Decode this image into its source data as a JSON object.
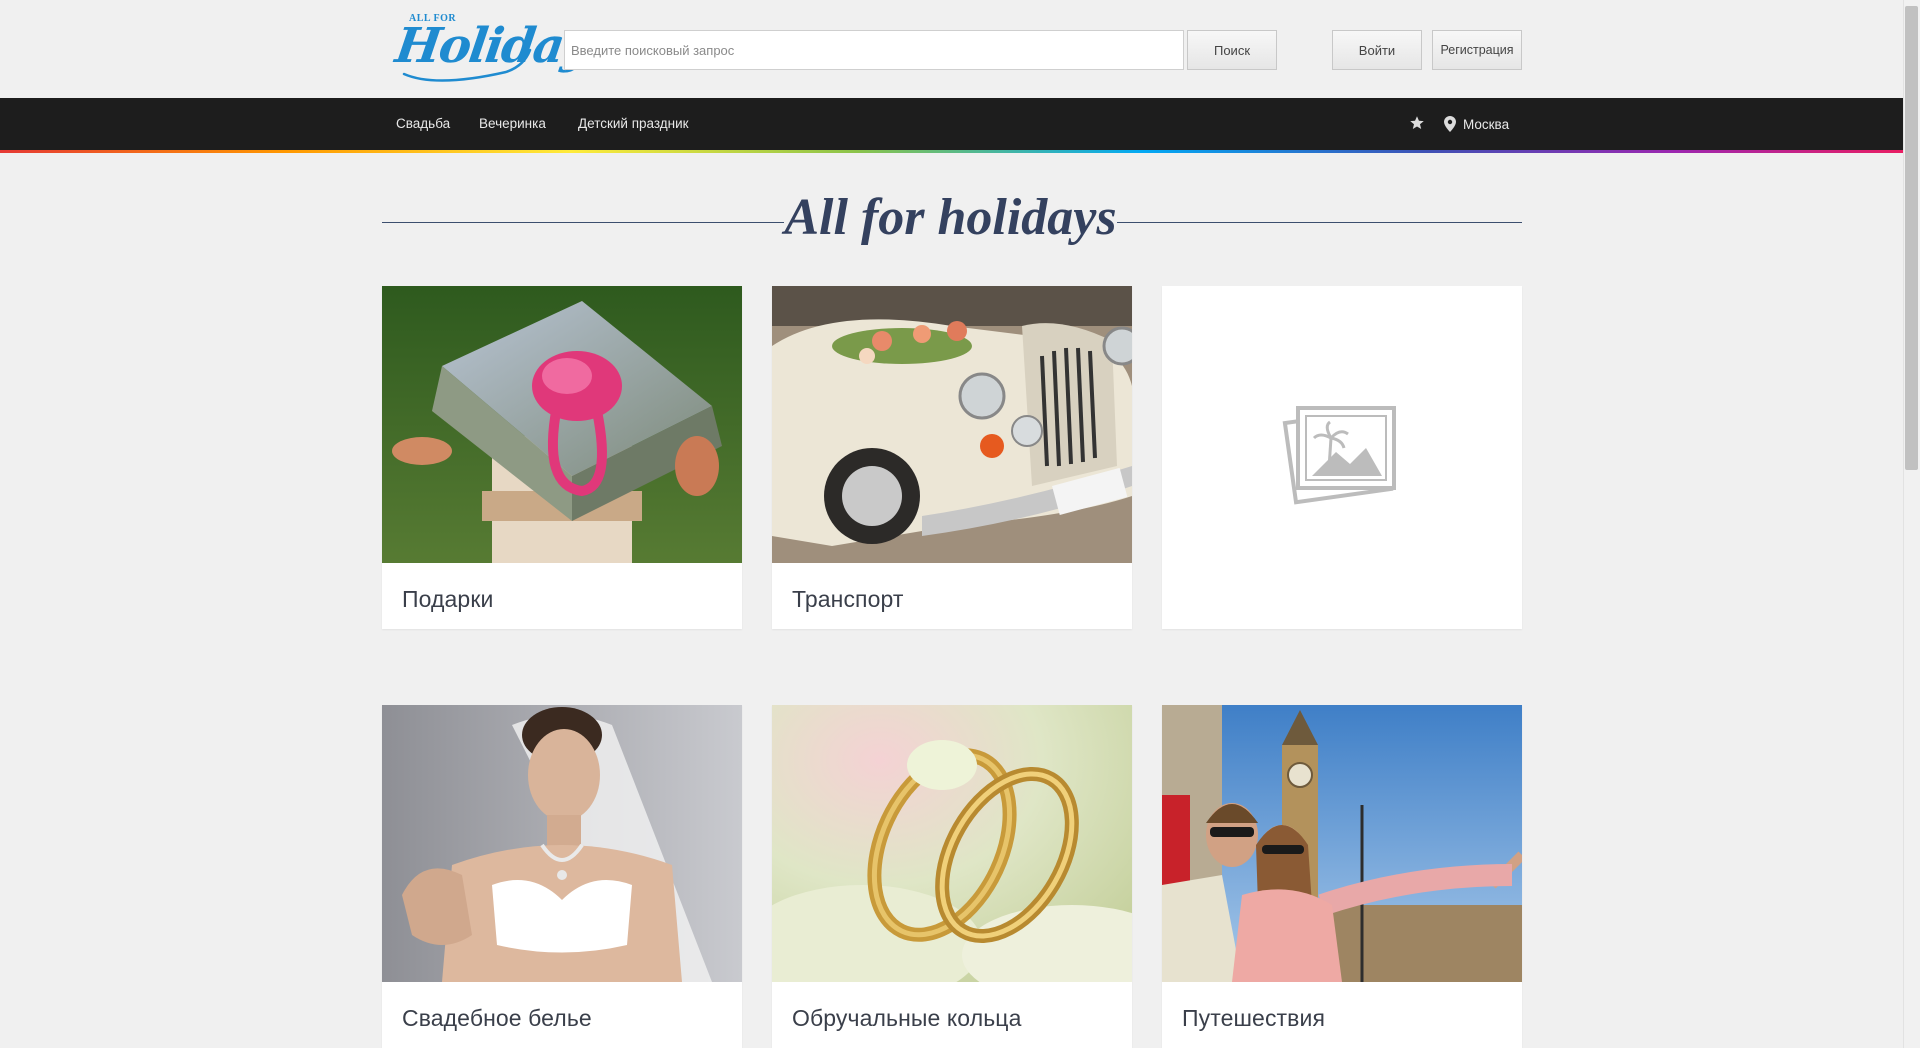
{
  "header": {
    "logo_small": "ALL FOR",
    "logo_big": "Holidays",
    "search_placeholder": "Введите поисковый запрос",
    "search_button": "Поиск",
    "login_button": "Войти",
    "register_button": "Регистрация"
  },
  "nav": {
    "items": [
      {
        "label": "Свадьба"
      },
      {
        "label": "Вечеринка"
      },
      {
        "label": "Детский праздник"
      }
    ],
    "favorites_icon": "star-icon",
    "location_icon": "map-pin-icon",
    "city": "Москва"
  },
  "main": {
    "title": "All for holidays",
    "cards": [
      {
        "label": "Подарки",
        "image": "gift-box-photo"
      },
      {
        "label": "Транспорт",
        "image": "wedding-car-photo"
      },
      {
        "label": "",
        "image": "image-placeholder-icon"
      },
      {
        "label": "Свадебное белье",
        "image": "bride-lingerie-photo"
      },
      {
        "label": "Обручальные кольца",
        "image": "wedding-rings-photo"
      },
      {
        "label": "Путешествия",
        "image": "travel-london-photo"
      }
    ]
  },
  "colors": {
    "brand_blue": "#1f8bd0",
    "navbar": "#1d1d1d",
    "title": "#34415f",
    "background": "#f0f0f0"
  }
}
